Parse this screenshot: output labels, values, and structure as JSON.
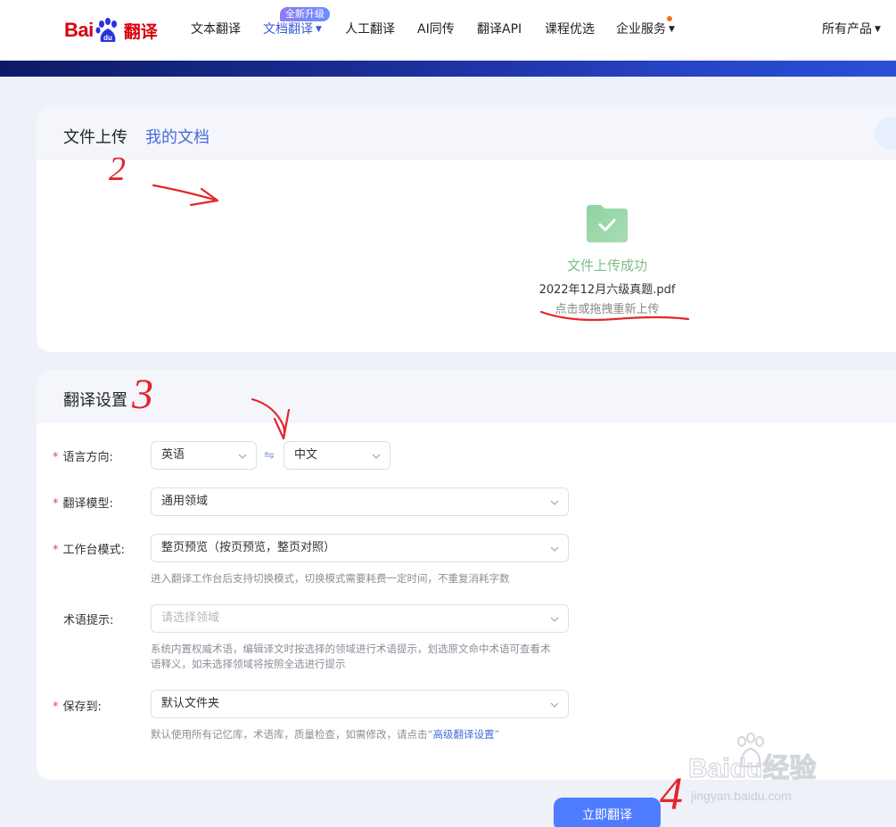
{
  "brand": {
    "logo_bai": "Bai",
    "logo_du": "du",
    "logo_product": "翻译"
  },
  "nav": {
    "items": [
      "文本翻译",
      "文档翻译",
      "人工翻译",
      "AI同传",
      "翻译API",
      "课程优选",
      "企业服务"
    ],
    "badge": "全新升级",
    "right": "所有产品"
  },
  "upload": {
    "tab_upload": "文件上传",
    "tab_docs": "我的文档",
    "success_title": "文件上传成功",
    "file_name": "2022年12月六级真题.pdf",
    "reupload": "点击或拖拽重新上传"
  },
  "settings": {
    "title": "翻译设置",
    "lang_label": "语言方向:",
    "source_lang": "英语",
    "target_lang": "中文",
    "swap_icon": "⇋",
    "model_label": "翻译模型:",
    "model_value": "通用领域",
    "mode_label": "工作台模式:",
    "mode_value": "整页预览（按页预览，整页对照）",
    "mode_hint": "进入翻译工作台后支持切换模式，切换模式需要耗费一定时间，不重复消耗字数",
    "term_label": "术语提示:",
    "term_placeholder": "请选择领域",
    "term_hint_1": "系统内置权威术语，编辑译文时按选择的领域进行术语提示，划选原文命中术语可查看术",
    "term_hint_2": "语释义，如未选择领域将按照全选进行提示",
    "save_label": "保存到:",
    "save_value": "默认文件夹",
    "save_hint_prefix": "默认使用所有记忆库，术语库，质量检查，如需修改，请点击“",
    "save_hint_link": "高级翻译设置",
    "save_hint_suffix": "”"
  },
  "action": {
    "translate": "立即翻译"
  },
  "annotations": {
    "n2": "2",
    "n3": "3",
    "n4": "4"
  },
  "watermark": {
    "text": "jingyan.baidu.com",
    "logo_text": "Baidu经验"
  },
  "colors": {
    "accent": "#4e7bff",
    "success": "#7bbf8a",
    "annotation_red": "#e3262d",
    "brand_red": "#d7000f"
  }
}
